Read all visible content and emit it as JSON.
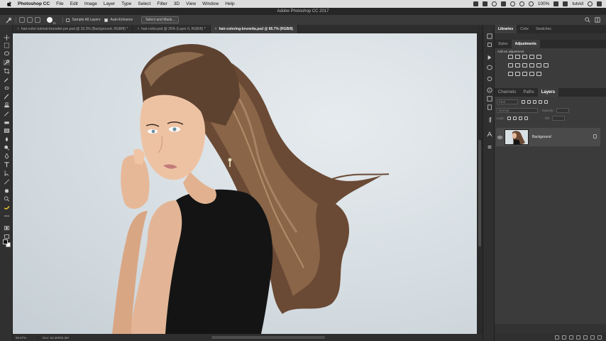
{
  "menubar": {
    "app_name": "Photoshop CC",
    "items": [
      "File",
      "Edit",
      "Image",
      "Layer",
      "Type",
      "Select",
      "Filter",
      "3D",
      "View",
      "Window",
      "Help"
    ],
    "battery": "100%",
    "user": "tutvid"
  },
  "window": {
    "title": "Adobe Photoshop CC 2017"
  },
  "options_bar": {
    "brush_size": "70",
    "sample_all_layers": "Sample All Layers",
    "auto_enhance": "Auto-Enhance",
    "select_mask_button": "Select and Mask..."
  },
  "document_tabs": [
    {
      "label": "hair-color-tutorial-brunette-pre.psd @ 33.3% (Background, RGB/8) *",
      "active": false
    },
    {
      "label": "hair-color.psd @ 25% (Layer 6, RGB/8) *",
      "active": false
    },
    {
      "label": "hair-coloring-brunetta.psd @ 66.7% (RGB/8)",
      "active": true
    }
  ],
  "status": {
    "zoom": "66.67%",
    "doc": "Doc: 63.3M/63.3M"
  },
  "panels": {
    "top_tabs": [
      "Libraries",
      "Color",
      "Swatches"
    ],
    "sub_tabs": [
      "Styles",
      "Adjustments"
    ],
    "add_adjustment": "Add an adjustment",
    "layer_tabs": [
      "Channels",
      "Paths",
      "Layers"
    ],
    "kind_label": "Kind",
    "blend_mode": "Normal",
    "opacity_label": "Opacity:",
    "lock_label": "Lock:",
    "fill_label": "Fill:",
    "layers": [
      {
        "name": "Background",
        "visible": true,
        "locked": true
      }
    ]
  },
  "colors": {
    "accent": "#4a4a4a",
    "canvas_bg": "#dbe2e6"
  }
}
